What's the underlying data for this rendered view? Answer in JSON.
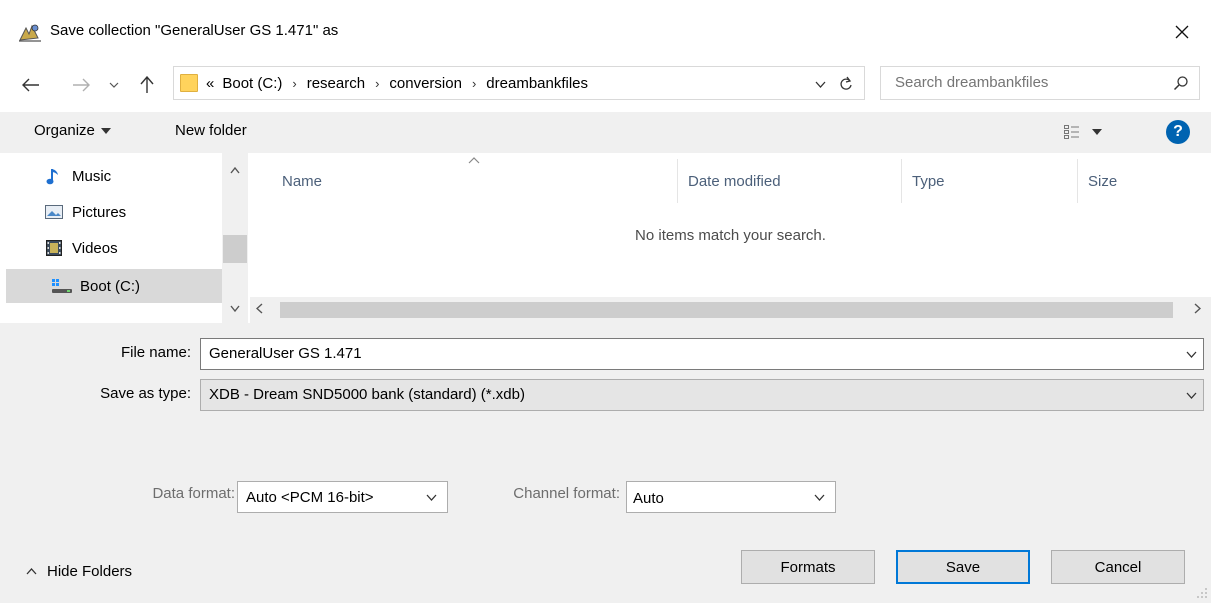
{
  "window": {
    "title": "Save collection \"GeneralUser GS 1.471\" as",
    "close_glyph": "✕"
  },
  "address": {
    "prefix": "«",
    "crumbs": [
      "Boot (C:)",
      "research",
      "conversion",
      "dreambankfiles"
    ],
    "separator": "›"
  },
  "search": {
    "placeholder": "Search dreambankfiles"
  },
  "toolbar": {
    "organize_label": "Organize",
    "new_folder_label": "New folder"
  },
  "nav": {
    "items": [
      {
        "label": "Music",
        "icon": "music-note-icon"
      },
      {
        "label": "Pictures",
        "icon": "pictures-icon"
      },
      {
        "label": "Videos",
        "icon": "videos-icon"
      },
      {
        "label": "Boot (C:)",
        "icon": "drive-icon",
        "selected": true
      }
    ]
  },
  "file_list": {
    "columns": [
      "Name",
      "Date modified",
      "Type",
      "Size"
    ],
    "empty_message": "No items match your search."
  },
  "form": {
    "file_name_label": "File name:",
    "file_name_value": "GeneralUser GS 1.471",
    "save_type_label": "Save as type:",
    "save_type_value": "XDB - Dream SND5000 bank (standard) (*.xdb)",
    "data_format_label": "Data format:",
    "data_format_value": "Auto <PCM 16-bit>",
    "channel_format_label": "Channel format:",
    "channel_format_value": "Auto"
  },
  "footer": {
    "hide_folders_label": "Hide Folders",
    "formats_button": "Formats",
    "save_button": "Save",
    "cancel_button": "Cancel"
  },
  "colors": {
    "accent": "#0078d7",
    "help_icon": "#0063b1",
    "selected_nav": "#d9d9d9",
    "panel_bg": "#f0f0f0"
  }
}
